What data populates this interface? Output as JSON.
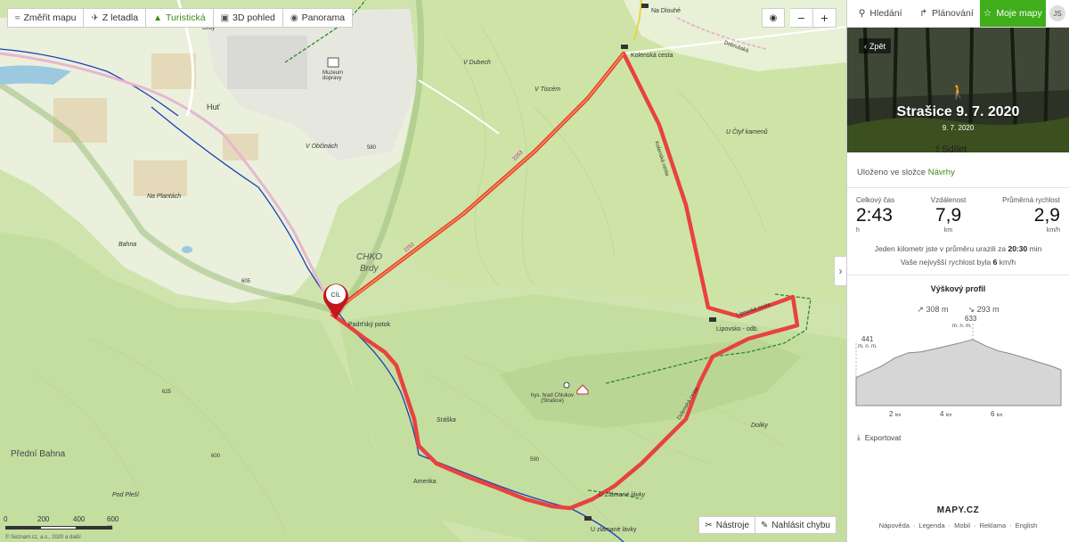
{
  "toolbar": {
    "measure": "Změřit mapu",
    "aerial": "Z letadla",
    "tourist": "Turistická",
    "view3d": "3D pohled",
    "panorama": "Panorama"
  },
  "zoom": {
    "locate": "◉",
    "out": "−",
    "in": "+"
  },
  "bottom_tools": {
    "tools": "Nástroje",
    "report": "Nahlásit chybu"
  },
  "scale": {
    "labels": [
      "0",
      "200",
      "400",
      "600 m"
    ]
  },
  "copyright": "© Seznam.cz, a.s., 2020 a další",
  "goal_label": "CÍL",
  "map_labels": {
    "na_dlouhe": "Na Dlouhé",
    "kolenska_cesta": "Kolenská cesta",
    "brdy_town": "Brdy",
    "muzeum": "Muzeum dopravy",
    "v_dubech": "V Dubech",
    "v_tiscem": "V Tiscém",
    "v_obcinach": "V Občinách",
    "na_plantach": "Na Plantách",
    "hut": "Huť",
    "bahna": "Bahna",
    "chko": "CHKO",
    "chko_brdy": "Brdy",
    "u_cty": "U Čtyř kamenů",
    "lipovsko": "Lipovsko - odb.",
    "hrad": "hys. hrad Chlukov (Strašice)",
    "sraska": "Sráška",
    "doliky": "Doliky",
    "predni_bahna": "Přední Bahna",
    "pod_plesi": "Pod Pleší",
    "amerika": "Amerika",
    "u_zlamane": "U Zlámané lávky",
    "u_zlamane_stop": "U zlámané lávky",
    "padrsky": "Padrťský potok",
    "elev_580": "580",
    "elev_605": "605",
    "elev_600": "600",
    "elev_625": "625",
    "elev_590": "590",
    "rd_2252": "2252",
    "rd_2253": "2253",
    "kolenska_road": "Kolenská cesta",
    "dolni_cesta": "Dolenská cesta",
    "dobruska": "Dobrušská",
    "dudocim": "Dolnověská",
    "lipovska": "Lipovská cesta"
  },
  "sidebar": {
    "tabs": {
      "search": "Hledání",
      "plan": "Plánování",
      "mymaps": "Moje mapy",
      "avatar": "JS"
    },
    "back": "Zpět",
    "title": "Strašice 9. 7. 2020",
    "date": "9. 7. 2020",
    "share": "Sdílet",
    "folder_prefix": "Uloženo ve složce",
    "folder_name": "Návrhy",
    "stats": {
      "time_label": "Celkový čas",
      "time_value": "2:43",
      "time_unit": "h",
      "distance_label": "Vzdálenost",
      "distance_value": "7,9",
      "distance_unit": "km",
      "speed_label": "Průměrná rychlost",
      "speed_value": "2,9",
      "speed_unit": "km/h"
    },
    "pace_line_1_a": "Jeden kilometr jste v průměru urazili za",
    "pace_line_1_b": "20:30",
    "pace_line_1_c": "min",
    "pace_line_2_a": "Vaše nejvyšší rychlost byla",
    "pace_line_2_b": "6",
    "pace_line_2_c": "km/h",
    "profile_title": "Výškový profil",
    "ascent": "308 m",
    "descent": "293 m",
    "elev_max": "633",
    "elev_max_unit": "m. n. m.",
    "elev_start": "441",
    "elev_start_unit": "m. n. m.",
    "profile_ticks": [
      "2",
      "4",
      "6"
    ],
    "tick_unit": "km",
    "export": "Exportovat",
    "logo": "MAPY.CZ",
    "footer_links": [
      "Nápověda",
      "Legenda",
      "Mobil",
      "Reklama",
      "English"
    ]
  },
  "colors": {
    "accent": "#3fae1a",
    "route": "#e8423f",
    "forest": "#c8e0a4",
    "meadow": "#e7f1d4"
  },
  "elevation_profile": {
    "x_km": [
      0,
      0.5,
      1,
      1.5,
      2,
      2.5,
      3,
      3.5,
      4,
      4.5,
      5,
      5.5,
      6,
      6.5,
      7,
      7.5,
      7.9
    ],
    "elev_m": [
      441,
      470,
      500,
      540,
      565,
      570,
      585,
      600,
      615,
      633,
      600,
      575,
      560,
      540,
      520,
      500,
      480
    ]
  }
}
